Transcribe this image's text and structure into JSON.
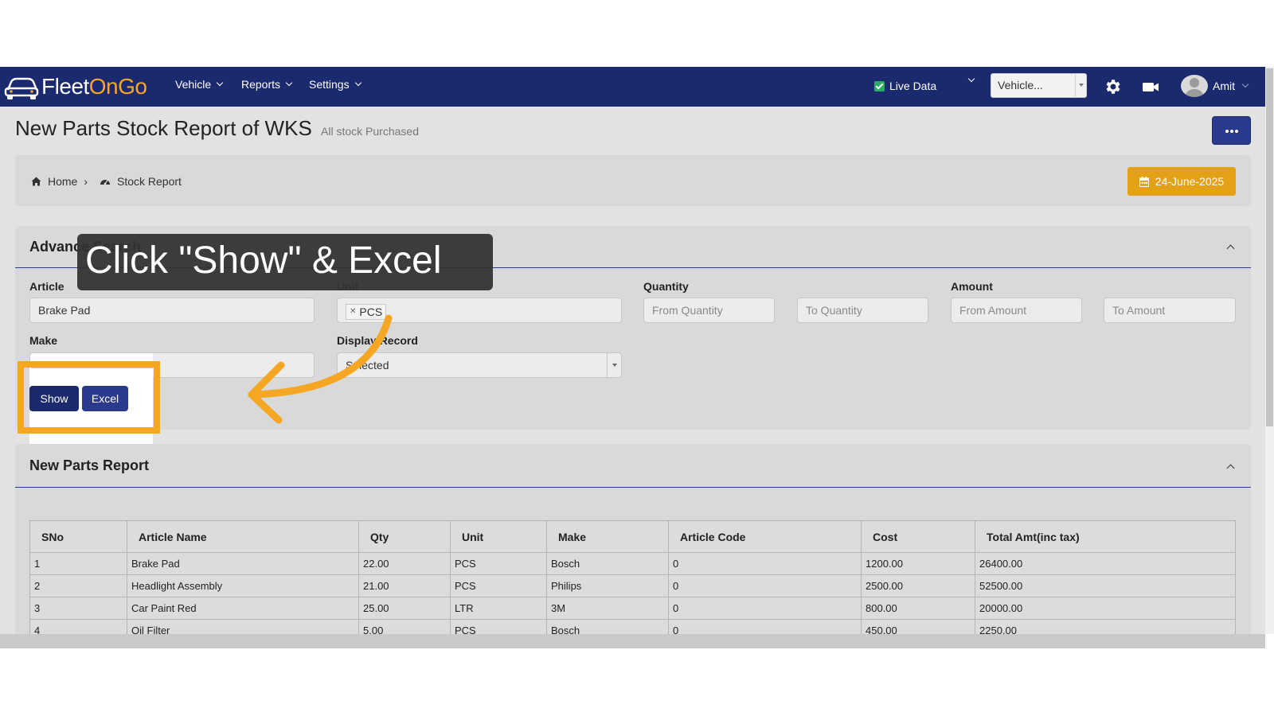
{
  "app": {
    "logo_part1": "Fleet",
    "logo_part2": "OnGo",
    "nav": [
      "Vehicle",
      "Reports",
      "Settings"
    ],
    "live_data_label": "Live Data",
    "vehicle_select": "Vehicle...",
    "user_name": "Amit"
  },
  "header": {
    "title": "New Parts Stock Report of WKS",
    "subtitle": "All stock Purchased",
    "breadcrumb": [
      "Home",
      "Stock Report"
    ],
    "breadcrumb_sep": "›",
    "date": "24-June-2025"
  },
  "search": {
    "title": "Advance Search",
    "article_label": "Article",
    "article_value": "Brake Pad",
    "unit_label": "Unit",
    "unit_tag": "PCS",
    "quantity_label": "Quantity",
    "from_qty_placeholder": "From Quantity",
    "to_qty_placeholder": "To Quantity",
    "amount_label": "Amount",
    "from_amt_placeholder": "From Amount",
    "to_amt_placeholder": "To Amount",
    "make_label": "Make",
    "make_placeholder": "Make",
    "display_label": "Display Record",
    "display_value": "Selected",
    "show_button": "Show",
    "excel_button": "Excel"
  },
  "report": {
    "title": "New Parts Report",
    "columns": [
      "SNo",
      "Article Name",
      "Qty",
      "Unit",
      "Make",
      "Article Code",
      "Cost",
      "Total Amt(inc tax)"
    ],
    "rows": [
      [
        "1",
        "Brake Pad",
        "22.00",
        "PCS",
        "Bosch",
        "0",
        "1200.00",
        "26400.00"
      ],
      [
        "2",
        "Headlight Assembly",
        "21.00",
        "PCS",
        "Philips",
        "0",
        "2500.00",
        "52500.00"
      ],
      [
        "3",
        "Car Paint Red",
        "25.00",
        "LTR",
        "3M",
        "0",
        "800.00",
        "20000.00"
      ],
      [
        "4",
        "Oil Filter",
        "5.00",
        "PCS",
        "Bosch",
        "0",
        "450.00",
        "2250.00"
      ]
    ]
  },
  "annotation": {
    "tooltip": "Click \"Show\" & Excel",
    "accent_color": "#f5a623"
  },
  "colors": {
    "navbar": "#1b2a6e",
    "date_button": "#e3a117",
    "primary_button": "#2a3a8c"
  }
}
